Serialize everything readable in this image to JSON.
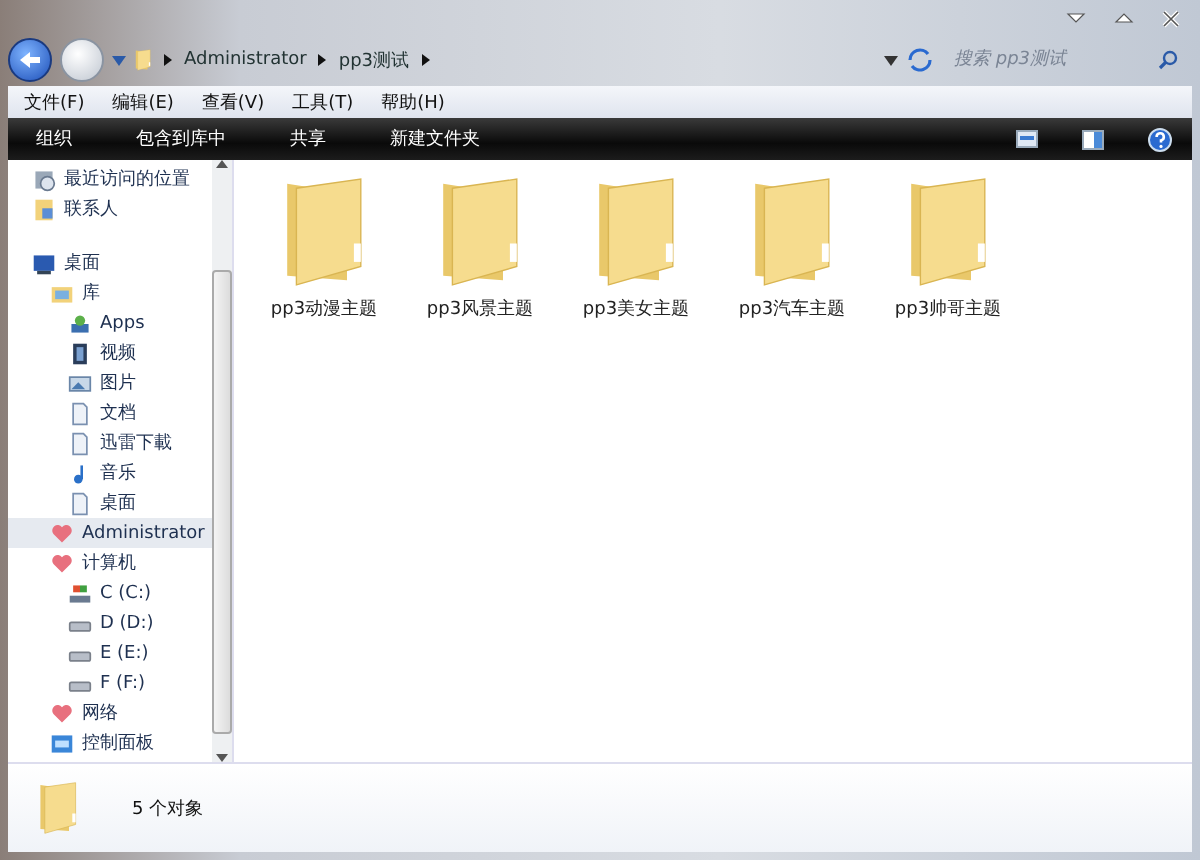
{
  "breadcrumb": [
    "Administrator",
    "pp3测试"
  ],
  "search": {
    "placeholder": "搜索 pp3测试"
  },
  "menu": [
    "文件(F)",
    "编辑(E)",
    "查看(V)",
    "工具(T)",
    "帮助(H)"
  ],
  "commands": [
    "组织",
    "包含到库中",
    "共享",
    "新建文件夹"
  ],
  "sidebar": [
    {
      "label": "最近访问的位置",
      "kind": "recent",
      "selected": false
    },
    {
      "label": "联系人",
      "kind": "contacts",
      "selected": false
    },
    {
      "label": "桌面",
      "kind": "desktop",
      "selected": false,
      "children": [
        {
          "label": "库",
          "kind": "library",
          "selected": false,
          "children": [
            {
              "label": "Apps",
              "kind": "apps",
              "selected": false
            },
            {
              "label": "视频",
              "kind": "video",
              "selected": false
            },
            {
              "label": "图片",
              "kind": "picture",
              "selected": false
            },
            {
              "label": "文档",
              "kind": "doc",
              "selected": false
            },
            {
              "label": "迅雷下載",
              "kind": "doc",
              "selected": false
            },
            {
              "label": "音乐",
              "kind": "music",
              "selected": false
            },
            {
              "label": "桌面",
              "kind": "doc",
              "selected": false
            }
          ]
        },
        {
          "label": "Administrator",
          "kind": "heart",
          "selected": true
        },
        {
          "label": "计算机",
          "kind": "heart",
          "selected": false,
          "children": [
            {
              "label": "C (C:)",
              "kind": "sysdrive",
              "selected": false
            },
            {
              "label": "D (D:)",
              "kind": "drive",
              "selected": false
            },
            {
              "label": "E (E:)",
              "kind": "drive",
              "selected": false
            },
            {
              "label": "F (F:)",
              "kind": "drive",
              "selected": false
            }
          ]
        },
        {
          "label": "网络",
          "kind": "heart",
          "selected": false
        },
        {
          "label": "控制面板",
          "kind": "panel",
          "selected": false
        }
      ]
    }
  ],
  "folders": [
    {
      "name": "pp3动漫主题"
    },
    {
      "name": "pp3风景主题"
    },
    {
      "name": "pp3美女主题"
    },
    {
      "name": "pp3汽车主题"
    },
    {
      "name": "pp3帅哥主题"
    }
  ],
  "status": "5 个对象"
}
